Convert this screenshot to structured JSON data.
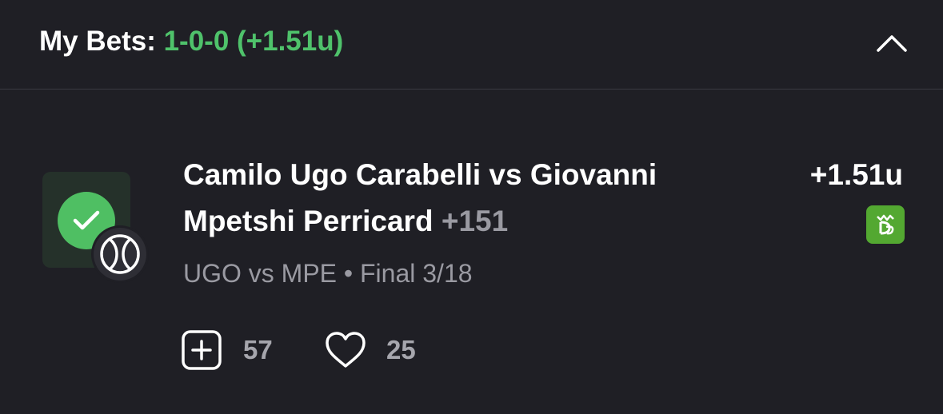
{
  "header": {
    "label": "My Bets: ",
    "record": "1-0-0 (+1.51u)",
    "collapse_icon": "chevron-up-icon"
  },
  "bet": {
    "status_icon": "check-icon",
    "status_color": "#4fbf63",
    "sport_icon": "tennis-ball-icon",
    "title": "Camilo Ugo Carabelli vs Giovanni Mpetshi Perricard ",
    "odds": "+151",
    "result": "+1.51u",
    "sportsbook_icon": "draftkings-logo-icon",
    "sportsbook_color": "#53a831",
    "subtitle": "UGO vs MPE • Final 3/18"
  },
  "actions": {
    "tail_icon": "plus-square-icon",
    "tail_count": "57",
    "like_icon": "heart-icon",
    "like_count": "25"
  }
}
